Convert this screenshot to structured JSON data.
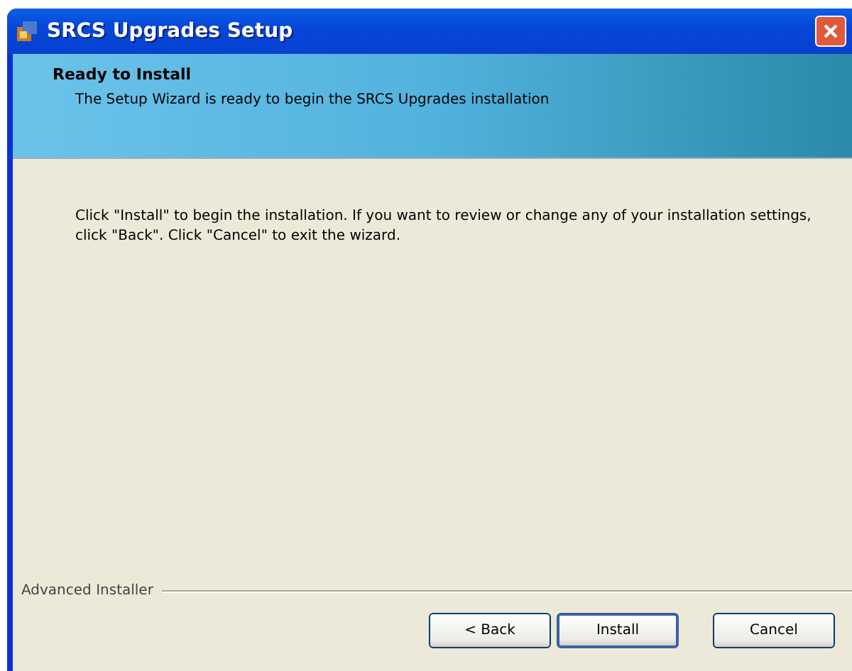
{
  "window": {
    "title": "SRCS Upgrades Setup"
  },
  "header": {
    "title": "Ready to Install",
    "subtitle": "The Setup Wizard is ready to begin the SRCS Upgrades installation"
  },
  "body": {
    "text": "Click \"Install\" to begin the installation.  If you want to review or change any of your installation settings, click \"Back\".  Click \"Cancel\" to exit the wizard."
  },
  "footer": {
    "brand": "Advanced Installer"
  },
  "buttons": [
    {
      "label": "< Back",
      "default": false
    },
    {
      "label": "Install",
      "default": true
    },
    {
      "label": "Cancel",
      "default": false
    }
  ]
}
